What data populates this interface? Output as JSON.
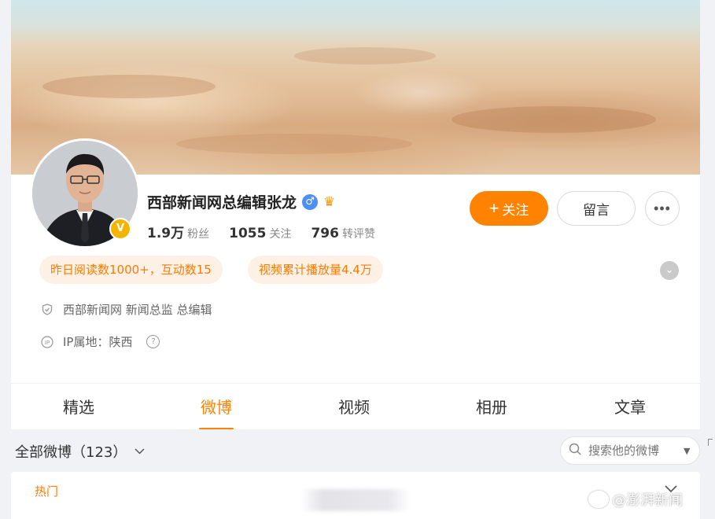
{
  "profile": {
    "name": "西部新闻网总编辑张龙",
    "verified_badge": "V",
    "stats": [
      {
        "value": "1.9万",
        "label": "粉丝"
      },
      {
        "value": "1055",
        "label": "关注"
      },
      {
        "value": "796",
        "label": "转评赞"
      }
    ],
    "follow_label": "关注",
    "follow_plus": "+",
    "message_label": "留言",
    "more_label": "•••"
  },
  "highlights": [
    "昨日阅读数1000+，互动数15",
    "视频累计播放量4.4万"
  ],
  "info": {
    "org": "西部新闻网 新闻总监 总编辑",
    "ip": "IP属地：陕西"
  },
  "tabs": [
    {
      "label": "精选"
    },
    {
      "label": "微博",
      "active": true
    },
    {
      "label": "视频"
    },
    {
      "label": "相册"
    },
    {
      "label": "文章"
    }
  ],
  "feed": {
    "filter_label": "全部微博（123）",
    "search_placeholder": "搜索他的微博",
    "hot_label": "热门"
  },
  "watermark": {
    "text": "@澎湃新闻"
  },
  "colors": {
    "accent": "#ff8200",
    "pill_bg": "#fdf1e6",
    "page_bg": "#f1f2f5"
  },
  "icons": [
    "male-icon",
    "crown-icon",
    "shield-icon",
    "ip-icon",
    "help-icon",
    "search-icon",
    "chevron-down-icon",
    "expand-icon"
  ]
}
